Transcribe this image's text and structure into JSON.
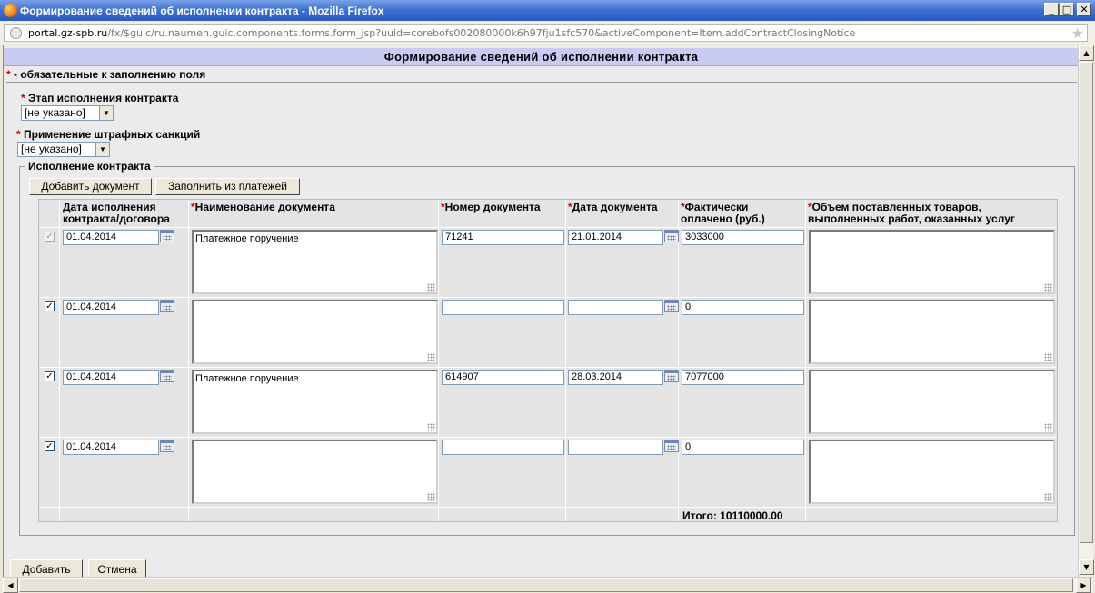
{
  "window": {
    "title": "Формирование сведений об исполнении контракта - Mozilla Firefox",
    "url_domain": "portal.gz-spb.ru",
    "url_rest": "/fx/$guic/ru.naumen.guic.components.forms.form_jsp?uuid=corebofs002080000k6h97fju1sfc570&activeComponent=Item.addContractClosingNotice"
  },
  "page": {
    "header": "Формирование сведений об исполнении контракта",
    "required_star": "*",
    "required_note": " - обязательные к заполнению поля"
  },
  "fields": {
    "stage_label": "Этап исполнения контракта",
    "stage_value": "[не указано]",
    "penalty_label": "Применение штрафных санкций",
    "penalty_value": "[не указано]"
  },
  "section": {
    "legend": "Исполнение контракта",
    "add_document_button": "Добавить документ",
    "fill_from_payments_button": "Заполнить из платежей"
  },
  "table": {
    "headers": {
      "date_exec_1": "Дата исполнения",
      "date_exec_2": "контракта/договора",
      "doc_name": "Наименование документа",
      "doc_number": "Номер документа",
      "doc_date": "Дата документа",
      "paid_1": "Фактически",
      "paid_2": "оплачено (руб.)",
      "volume_1": "Объем поставленных товаров,",
      "volume_2": "выполненных работ, оказанных услуг"
    },
    "rows": [
      {
        "exec_date": "01.04.2014",
        "doc_name": "Платежное поручение",
        "doc_number": "71241",
        "doc_date": "21.01.2014",
        "paid": "3033000",
        "volume": "",
        "checked": true,
        "disabled": true
      },
      {
        "exec_date": "01.04.2014",
        "doc_name": "",
        "doc_number": "",
        "doc_date": "",
        "paid": "0",
        "volume": "",
        "checked": true,
        "disabled": false
      },
      {
        "exec_date": "01.04.2014",
        "doc_name": "Платежное поручение",
        "doc_number": "614907",
        "doc_date": "28.03.2014",
        "paid": "7077000",
        "volume": "",
        "checked": true,
        "disabled": false
      },
      {
        "exec_date": "01.04.2014",
        "doc_name": "",
        "doc_number": "",
        "doc_date": "",
        "paid": "0",
        "volume": "",
        "checked": true,
        "disabled": false
      }
    ],
    "total": "Итого: 10110000.00"
  },
  "footer": {
    "add_button": "Добавить",
    "cancel_button": "Отмена"
  },
  "icons": {
    "checkmark": "✓",
    "dropdown": "▼",
    "scroll_up": "▲",
    "scroll_down": "▼",
    "scroll_left": "◀",
    "scroll_right": "▶",
    "minimize": "_",
    "maximize": "□",
    "close": "✕",
    "star": "★"
  }
}
